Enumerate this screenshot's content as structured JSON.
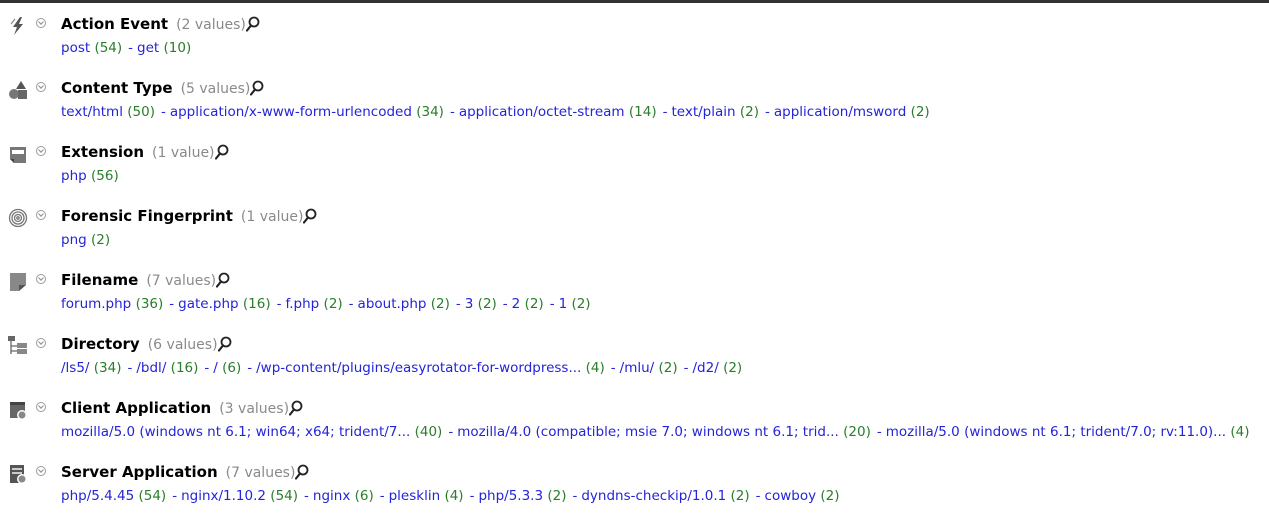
{
  "facets": [
    {
      "title": "Action Event",
      "count_label": "(2 values)",
      "icon": "lightning-icon",
      "values": [
        {
          "label": "post",
          "count": "(54)"
        },
        {
          "label": "get",
          "count": "(10)"
        }
      ]
    },
    {
      "title": "Content Type",
      "count_label": "(5 values)",
      "icon": "shapes-icon",
      "values": [
        {
          "label": "text/html",
          "count": "(50)"
        },
        {
          "label": "application/x-www-form-urlencoded",
          "count": "(34)"
        },
        {
          "label": "application/octet-stream",
          "count": "(14)"
        },
        {
          "label": "text/plain",
          "count": "(2)"
        },
        {
          "label": "application/msword",
          "count": "(2)"
        }
      ]
    },
    {
      "title": "Extension",
      "count_label": "(1 value)",
      "icon": "file-extension-icon",
      "values": [
        {
          "label": "php",
          "count": "(56)"
        }
      ]
    },
    {
      "title": "Forensic Fingerprint",
      "count_label": "(1 value)",
      "icon": "fingerprint-icon",
      "values": [
        {
          "label": "png",
          "count": "(2)"
        }
      ]
    },
    {
      "title": "Filename",
      "count_label": "(7 values)",
      "icon": "file-icon",
      "values": [
        {
          "label": "forum.php",
          "count": "(36)"
        },
        {
          "label": "gate.php",
          "count": "(16)"
        },
        {
          "label": "f.php",
          "count": "(2)"
        },
        {
          "label": "about.php",
          "count": "(2)"
        },
        {
          "label": "3",
          "count": "(2)"
        },
        {
          "label": "2",
          "count": "(2)"
        },
        {
          "label": "1",
          "count": "(2)"
        }
      ]
    },
    {
      "title": "Directory",
      "count_label": "(6 values)",
      "icon": "directory-tree-icon",
      "values": [
        {
          "label": "/ls5/",
          "count": "(34)"
        },
        {
          "label": "/bdl/",
          "count": "(16)"
        },
        {
          "label": "/",
          "count": "(6)"
        },
        {
          "label": "/wp-content/plugins/easyrotator-for-wordpress...",
          "count": "(4)"
        },
        {
          "label": "/mlu/",
          "count": "(2)"
        },
        {
          "label": "/d2/",
          "count": "(2)"
        }
      ]
    },
    {
      "title": "Client Application",
      "count_label": "(3 values)",
      "icon": "client-application-icon",
      "values": [
        {
          "label": "mozilla/5.0 (windows nt 6.1; win64; x64; trident/7...",
          "count": "(40)"
        },
        {
          "label": "mozilla/4.0 (compatible; msie 7.0; windows nt 6.1; trid...",
          "count": "(20)"
        },
        {
          "label": "mozilla/5.0 (windows nt 6.1; trident/7.0; rv:11.0)...",
          "count": "(4)"
        }
      ]
    },
    {
      "title": "Server Application",
      "count_label": "(7 values)",
      "icon": "server-application-icon",
      "values": [
        {
          "label": "php/5.4.45",
          "count": "(54)"
        },
        {
          "label": "nginx/1.10.2",
          "count": "(54)"
        },
        {
          "label": "nginx",
          "count": "(6)"
        },
        {
          "label": "plesklin",
          "count": "(4)"
        },
        {
          "label": "php/5.3.3",
          "count": "(2)"
        },
        {
          "label": "dyndns-checkip/1.0.1",
          "count": "(2)"
        },
        {
          "label": "cowboy",
          "count": "(2)"
        }
      ]
    }
  ],
  "separator": "-",
  "colors": {
    "link": "#2424d8",
    "count": "#2a7d2a",
    "muted": "#8a8a8a",
    "topbar": "#333333"
  }
}
